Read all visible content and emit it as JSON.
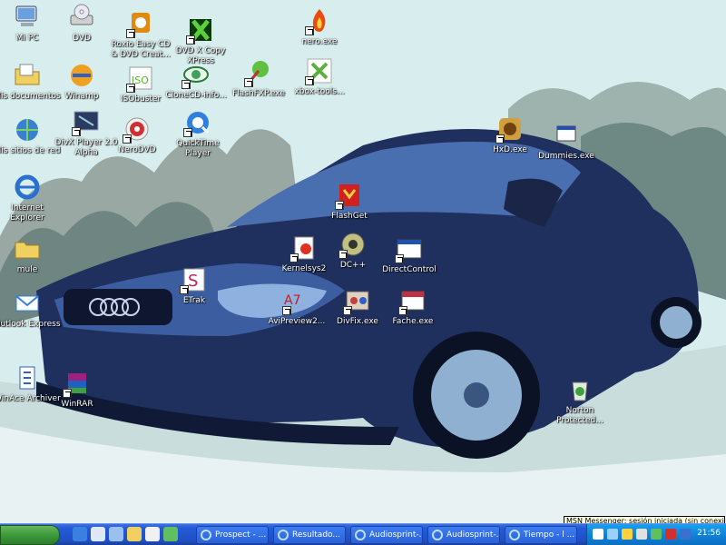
{
  "desktop": {
    "icons": [
      {
        "id": "mi-pc",
        "label": "Mi PC",
        "color": "#6aa0e0"
      },
      {
        "id": "dvd",
        "label": "DVD",
        "color": "#c8c8c8"
      },
      {
        "id": "roxio",
        "label": "Roxio Easy CD & DVD Creat...",
        "color": "#e08a10"
      },
      {
        "id": "dvdxcopy",
        "label": "DVD X Copy XPress",
        "color": "#1a9a1a"
      },
      {
        "id": "nero",
        "label": "nero.exe",
        "color": "#d82a10"
      },
      {
        "id": "misdocs",
        "label": "Mis documentos",
        "color": "#f0d060"
      },
      {
        "id": "winamp",
        "label": "Winamp",
        "color": "#f0a020"
      },
      {
        "id": "isobuster",
        "label": "ISObuster",
        "color": "#5ab030"
      },
      {
        "id": "cloneinfo",
        "label": "CloneCD-info...",
        "color": "#40a060"
      },
      {
        "id": "flashfxp",
        "label": "FlashFXP.exe",
        "color": "#40a040"
      },
      {
        "id": "xbox",
        "label": "xbox-tools...",
        "color": "#5cb040"
      },
      {
        "id": "red",
        "label": "Mis sitios de red",
        "color": "#3a80d0"
      },
      {
        "id": "dvdplayer",
        "label": "DivX Player 2.0 Alpha",
        "color": "#2a3a60"
      },
      {
        "id": "nerodvd",
        "label": "NeroDVD",
        "color": "#d03030"
      },
      {
        "id": "quicktime",
        "label": "QuickTime Player",
        "color": "#3080e0"
      },
      {
        "id": "hxdd",
        "label": "HxD.exe",
        "color": "#d0a040"
      },
      {
        "id": "dummies",
        "label": "Dummies.exe",
        "color": "#e0e0e0"
      },
      {
        "id": "ie",
        "label": "Internet Explorer",
        "color": "#2a70d0"
      },
      {
        "id": "flashget",
        "label": "FlashGet",
        "color": "#d02020"
      },
      {
        "id": "mule",
        "label": "mule",
        "color": "#f0d060"
      },
      {
        "id": "kernelsys",
        "label": "Kernelsys2",
        "color": "#e03020"
      },
      {
        "id": "dcpp",
        "label": "DC++",
        "color": "#c0c080"
      },
      {
        "id": "directcontrol",
        "label": "DirectControl",
        "color": "#2050b0"
      },
      {
        "id": "etrak",
        "label": "ETrak",
        "color": "#c02060"
      },
      {
        "id": "outlook",
        "label": "Outlook Express",
        "color": "#3080e0"
      },
      {
        "id": "avi",
        "label": "AviPreview2...",
        "color": "#c02020"
      },
      {
        "id": "divfix",
        "label": "DivFix.exe",
        "color": "#c04040"
      },
      {
        "id": "fache",
        "label": "Fache.exe",
        "color": "#c03040"
      },
      {
        "id": "winace",
        "label": "WinAce Archiver",
        "color": "#3060c0"
      },
      {
        "id": "winrar",
        "label": "WinRAR",
        "color": "#a02080"
      },
      {
        "id": "norton",
        "label": "Norton Protected...",
        "color": "#40a040"
      }
    ]
  },
  "notification": {
    "text": "MSN Messenger: sesión iniciada (sin conexión)"
  },
  "taskbar": {
    "start_color": "#3c9a3a",
    "tasks": [
      {
        "label": "Prospect - ..."
      },
      {
        "label": "Resultado..."
      },
      {
        "label": "Audiosprint-..."
      },
      {
        "label": "Audiosprint-..."
      },
      {
        "label": "Tiempo - l ..."
      }
    ],
    "clock": "21:56"
  }
}
